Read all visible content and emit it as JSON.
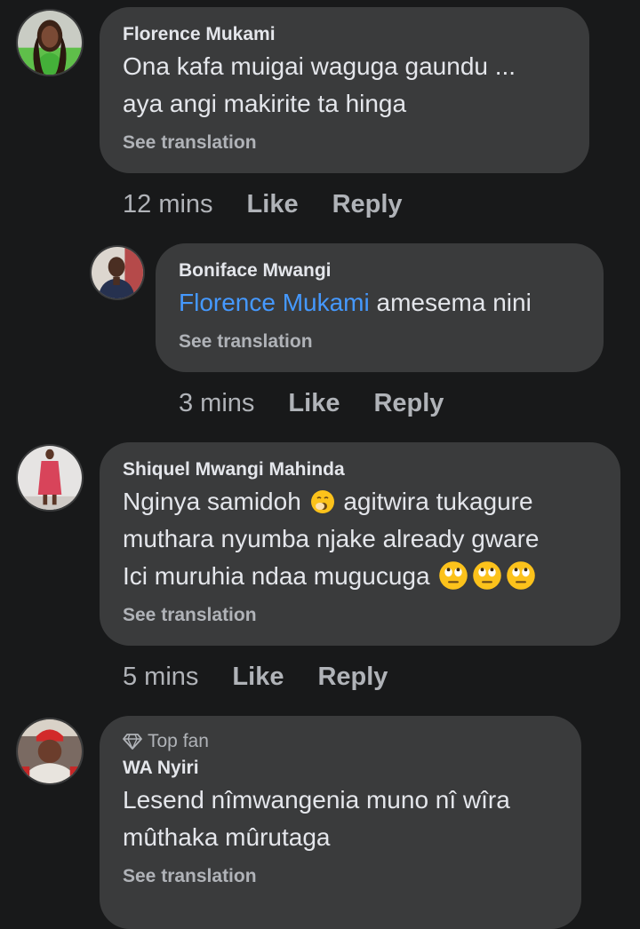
{
  "comments": [
    {
      "author": "Florence Mukami",
      "lines": [
        "Ona kafa muigai waguga gaundu ...",
        "aya angi makirite ta hinga"
      ],
      "see_translation": "See translation",
      "time": "12 mins",
      "like": "Like",
      "reply": "Reply"
    },
    {
      "author": "Boniface Mwangi",
      "mention": "Florence Mukami",
      "text": " amesema nini",
      "see_translation": "See translation",
      "time": "3 mins",
      "like": "Like",
      "reply": "Reply"
    },
    {
      "author": "Shiquel Mwangi Mahinda",
      "line1_a": "Nginya samidoh",
      "line1_b": "agitwira tukagure",
      "line2": "muthara nyumba njake already gware",
      "line3": "Ici muruhia ndaa mugucuga",
      "see_translation": "See translation",
      "time": "5 mins",
      "like": "Like",
      "reply": "Reply",
      "emojis": [
        "yawning-face-emoji",
        "eye-roll-emoji",
        "eye-roll-emoji",
        "eye-roll-emoji"
      ]
    },
    {
      "badge": "Top fan",
      "author": "WA Nyiri",
      "lines": [
        "Lesend nîmwangenia muno nî wîra",
        "mûthaka mûrutaga"
      ],
      "see_translation": "See translation"
    }
  ],
  "colors": {
    "background": "#18191a",
    "bubble": "#3a3b3c",
    "primary_text": "#e4e6eb",
    "secondary_text": "#b0b3b8",
    "mention": "#4599ff"
  }
}
